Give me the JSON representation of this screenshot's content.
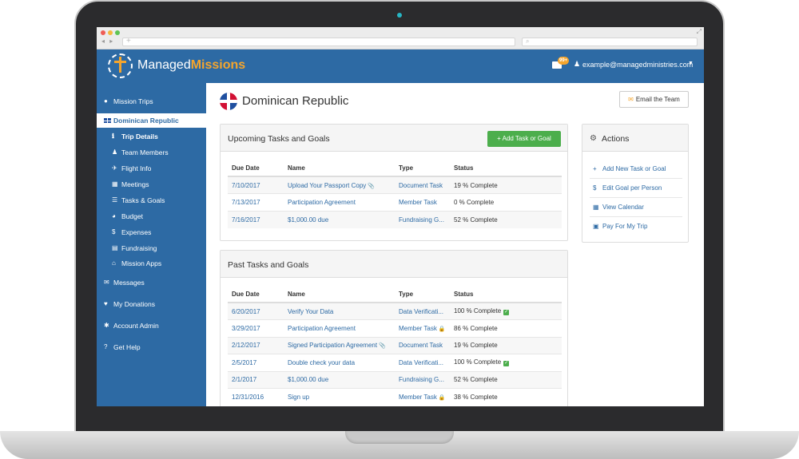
{
  "browser": {
    "nav_arrows": "◂ ▸"
  },
  "header": {
    "logo_text_main": "Managed",
    "logo_text_accent": "Missions",
    "badge_count": "99+",
    "user_email": "example@managedministries.com",
    "colors": {
      "primary": "#2d6aa4",
      "accent": "#f4a52d"
    }
  },
  "sidebar": {
    "items": [
      {
        "label": "Mission Trips",
        "icon": "globe-icon",
        "glyph": "●"
      },
      {
        "label": "Dominican Republic",
        "icon": "flag-icon",
        "glyph": ""
      },
      {
        "label": "Trip Details",
        "icon": "info-icon",
        "glyph": "ℹ"
      },
      {
        "label": "Team Members",
        "icon": "user-icon",
        "glyph": "♟"
      },
      {
        "label": "Flight Info",
        "icon": "plane-icon",
        "glyph": "✈"
      },
      {
        "label": "Meetings",
        "icon": "calendar-icon",
        "glyph": "▦"
      },
      {
        "label": "Tasks & Goals",
        "icon": "list-icon",
        "glyph": "☰"
      },
      {
        "label": "Budget",
        "icon": "pie-chart-icon",
        "glyph": "◕"
      },
      {
        "label": "Expenses",
        "icon": "dollar-icon",
        "glyph": "$"
      },
      {
        "label": "Fundraising",
        "icon": "credit-card-icon",
        "glyph": "▤"
      },
      {
        "label": "Mission Apps",
        "icon": "inbox-icon",
        "glyph": "⌂"
      },
      {
        "label": "Messages",
        "icon": "envelope-icon",
        "glyph": "✉"
      },
      {
        "label": "My Donations",
        "icon": "heart-icon",
        "glyph": "♥"
      },
      {
        "label": "Account Admin",
        "icon": "cog-icon",
        "glyph": "✱"
      },
      {
        "label": "Get Help",
        "icon": "question-icon",
        "glyph": "?"
      }
    ]
  },
  "page": {
    "title": "Dominican Republic",
    "email_team_label": "Email the Team"
  },
  "upcoming": {
    "title": "Upcoming Tasks and Goals",
    "add_button_label": "Add Task or Goal",
    "columns": [
      "Due Date",
      "Name",
      "Type",
      "Status"
    ],
    "rows": [
      {
        "date": "7/10/2017",
        "name": "Upload Your Passport Copy",
        "type": "Document Task",
        "status": "19 % Complete",
        "attachment": true
      },
      {
        "date": "7/13/2017",
        "name": "Participation Agreement",
        "type": "Member Task",
        "status": "0 % Complete"
      },
      {
        "date": "7/16/2017",
        "name": "$1,000.00 due",
        "type": "Fundraising G...",
        "status": "52 % Complete"
      }
    ]
  },
  "past": {
    "title": "Past Tasks and Goals",
    "columns": [
      "Due Date",
      "Name",
      "Type",
      "Status"
    ],
    "rows": [
      {
        "date": "6/20/2017",
        "name": "Verify Your Data",
        "type": "Data Verificati...",
        "status": "100 % Complete",
        "done": true
      },
      {
        "date": "3/29/2017",
        "name": "Participation Agreement",
        "type": "Member Task",
        "status": "86 % Complete",
        "locked": true
      },
      {
        "date": "2/12/2017",
        "name": "Signed Participation Agreement",
        "type": "Document Task",
        "status": "19 % Complete",
        "attachment": true
      },
      {
        "date": "2/5/2017",
        "name": "Double check your data",
        "type": "Data Verificati...",
        "status": "100 % Complete",
        "done": true
      },
      {
        "date": "2/1/2017",
        "name": "$1,000.00 due",
        "type": "Fundraising G...",
        "status": "52 % Complete"
      },
      {
        "date": "12/31/2016",
        "name": "Sign up",
        "type": "Member Task",
        "status": "38 % Complete",
        "locked": true
      }
    ]
  },
  "actions": {
    "title": "Actions",
    "items": [
      {
        "label": "Add New Task or Goal",
        "icon": "plus-icon",
        "glyph": "+"
      },
      {
        "label": "Edit Goal per Person",
        "icon": "dollar-icon",
        "glyph": "$"
      },
      {
        "label": "View Calendar",
        "icon": "calendar-icon",
        "glyph": "▦"
      },
      {
        "label": "Pay For My Trip",
        "icon": "money-icon",
        "glyph": "▣"
      }
    ]
  }
}
